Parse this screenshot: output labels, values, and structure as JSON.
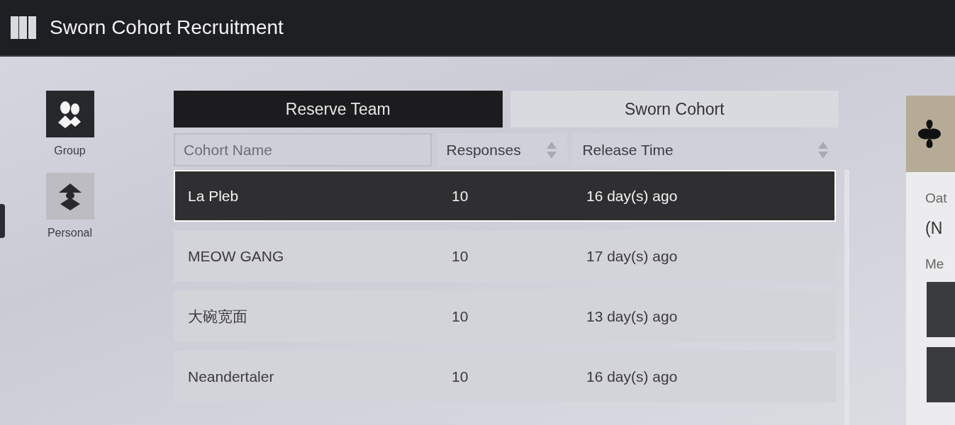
{
  "window": {
    "title": "Sworn Cohort Recruitment"
  },
  "sidebar": {
    "items": [
      {
        "label": "Group",
        "selected": true
      },
      {
        "label": "Personal",
        "selected": false
      }
    ]
  },
  "tabs": [
    {
      "label": "Reserve Team",
      "selected": true
    },
    {
      "label": "Sworn Cohort",
      "selected": false
    }
  ],
  "search": {
    "placeholder": "Cohort Name"
  },
  "columns": [
    {
      "label": "Responses"
    },
    {
      "label": "Release Time"
    }
  ],
  "rows": [
    {
      "name": "La Pleb",
      "responses": "10",
      "time": "16 day(s) ago",
      "selected": true
    },
    {
      "name": "MEOW GANG",
      "responses": "10",
      "time": "17 day(s) ago",
      "selected": false
    },
    {
      "name": "大碗宽面",
      "responses": "10",
      "time": "13 day(s) ago",
      "selected": false
    },
    {
      "name": "Neandertaler",
      "responses": "10",
      "time": "16 day(s) ago",
      "selected": false
    }
  ],
  "detail": {
    "oath_label": "Oat",
    "oath_value": "(N",
    "members_label": "Me"
  }
}
